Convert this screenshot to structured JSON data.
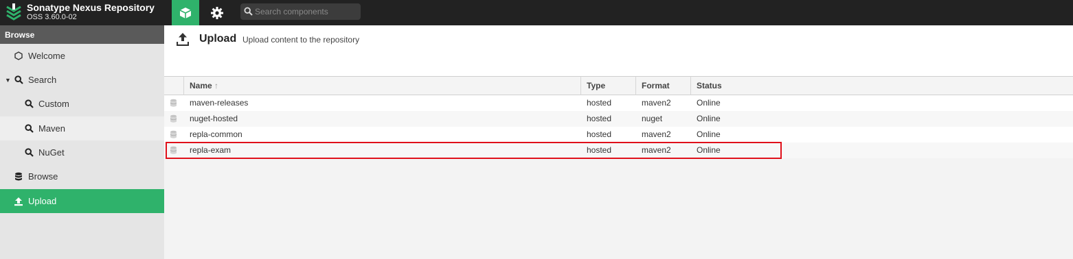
{
  "header": {
    "title": "Sonatype Nexus Repository",
    "version": "OSS 3.60.0-02",
    "browse_mode_icon": "cube-icon",
    "admin_mode_icon": "gear-icon",
    "search_placeholder": "Search components"
  },
  "sidebar": {
    "header": "Browse",
    "items": [
      {
        "label": "Welcome",
        "icon": "hexagon-icon"
      },
      {
        "label": "Search",
        "icon": "search-icon",
        "expanded": true
      },
      {
        "label": "Custom",
        "icon": "search-icon"
      },
      {
        "label": "Maven",
        "icon": "search-icon"
      },
      {
        "label": "NuGet",
        "icon": "search-icon"
      },
      {
        "label": "Browse",
        "icon": "database-icon"
      },
      {
        "label": "Upload",
        "icon": "upload-icon",
        "active": true
      }
    ]
  },
  "main": {
    "title": "Upload",
    "subtitle": "Upload content to the repository",
    "columns": [
      "Name",
      "Type",
      "Format",
      "Status"
    ],
    "sort_indicator": "↑",
    "rows": [
      {
        "name": "maven-releases",
        "type": "hosted",
        "format": "maven2",
        "status": "Online"
      },
      {
        "name": "nuget-hosted",
        "type": "hosted",
        "format": "nuget",
        "status": "Online"
      },
      {
        "name": "repla-common",
        "type": "hosted",
        "format": "maven2",
        "status": "Online"
      },
      {
        "name": "repla-exam",
        "type": "hosted",
        "format": "maven2",
        "status": "Online",
        "highlighted": true
      }
    ]
  },
  "colors": {
    "accent": "#2fb26b",
    "topbar": "#222222",
    "highlight": "#e0101a"
  }
}
